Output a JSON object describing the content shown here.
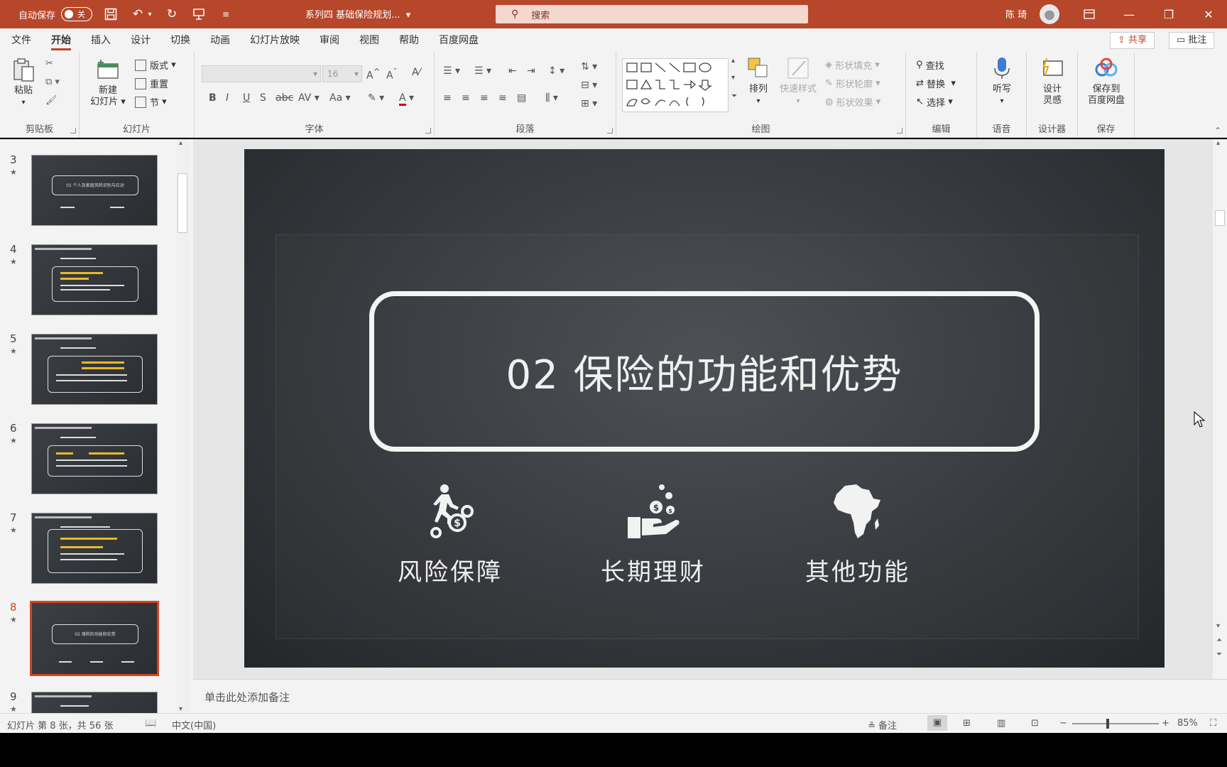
{
  "titlebar": {
    "autosave_label": "自动保存",
    "autosave_state": "关",
    "doc_title": "系列四 基础保险规划...",
    "search_placeholder": "搜索",
    "user_name": "陈 琦"
  },
  "tabs": [
    "文件",
    "开始",
    "插入",
    "设计",
    "切换",
    "动画",
    "幻灯片放映",
    "审阅",
    "视图",
    "帮助",
    "百度网盘"
  ],
  "active_tab": "开始",
  "share_label": "共享",
  "comment_label": "批注",
  "ribbon": {
    "clipboard": {
      "paste": "粘贴",
      "label": "剪贴板"
    },
    "slides": {
      "new_slide_1": "新建",
      "new_slide_2": "幻灯片",
      "layout": "版式",
      "reset": "重置",
      "section": "节",
      "label": "幻灯片"
    },
    "font": {
      "font_size": "16",
      "label": "字体"
    },
    "paragraph": {
      "label": "段落"
    },
    "drawing": {
      "arrange": "排列",
      "quick_styles": "快速样式",
      "shape_fill": "形状填充",
      "shape_outline": "形状轮廓",
      "shape_effects": "形状效果",
      "label": "绘图"
    },
    "editing": {
      "find": "查找",
      "replace": "替换",
      "select": "选择",
      "label": "编辑"
    },
    "voice": {
      "dictate": "听写",
      "label": "语音"
    },
    "designer": {
      "design_ideas_1": "设计",
      "design_ideas_2": "灵感",
      "label": "设计器"
    },
    "save": {
      "save_baidu_1": "保存到",
      "save_baidu_2": "百度网盘",
      "label": "保存"
    }
  },
  "thumbnails": [
    {
      "num": "3",
      "title": "01 个人及家庭风险识别与应对"
    },
    {
      "num": "4",
      "title": ""
    },
    {
      "num": "5",
      "title": ""
    },
    {
      "num": "6",
      "title": ""
    },
    {
      "num": "7",
      "title": ""
    },
    {
      "num": "8",
      "title": "02 保险的功能和优势",
      "selected": true
    },
    {
      "num": "9",
      "title": ""
    }
  ],
  "slide": {
    "title": "02  保险的功能和优势",
    "features": [
      {
        "label": "风险保障",
        "icon": "runner-gears-icon"
      },
      {
        "label": "长期理财",
        "icon": "hand-coins-icon"
      },
      {
        "label": "其他功能",
        "icon": "africa-map-icon"
      }
    ]
  },
  "notes_placeholder": "单击此处添加备注",
  "status": {
    "slide_info": "幻灯片 第 8 张，共 56 张",
    "language": "中文(中国)",
    "notes_btn": "备注",
    "zoom": "85%"
  }
}
